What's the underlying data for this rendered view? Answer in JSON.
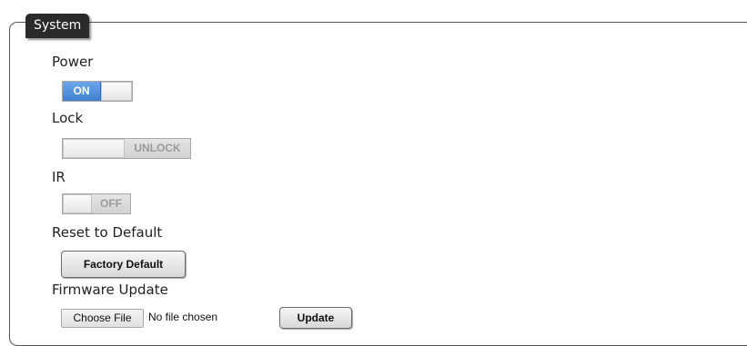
{
  "panel": {
    "title": "System"
  },
  "power": {
    "label": "Power",
    "state_text": "ON",
    "checked": true
  },
  "lock": {
    "label": "Lock",
    "state_text": "UNLOCK",
    "checked": false
  },
  "ir": {
    "label": "IR",
    "state_text": "OFF",
    "checked": false
  },
  "reset": {
    "label": "Reset to Default",
    "button_label": "Factory Default"
  },
  "firmware": {
    "label": "Firmware Update",
    "choose_label": "Choose File",
    "file_status": "No file chosen",
    "update_label": "Update"
  }
}
